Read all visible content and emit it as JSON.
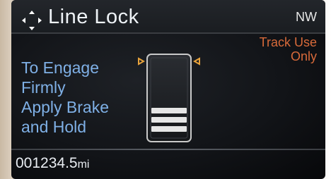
{
  "header": {
    "title": "Line Lock",
    "compass": "NW"
  },
  "notice": {
    "line1": "Track Use",
    "line2": "Only"
  },
  "instruction": {
    "lines": [
      "To Engage",
      "Firmly",
      "Apply Brake",
      "and Hold"
    ]
  },
  "odometer": {
    "value": "001234.5",
    "unit": "mi"
  },
  "icons": {
    "nav": "four-way-arrows-icon",
    "pedal": "brake-pedal-icon"
  },
  "colors": {
    "title": "#eef2f6",
    "instruction": "#7fb0e6",
    "notice": "#d86a3a",
    "indicator": "#e8a33c"
  }
}
